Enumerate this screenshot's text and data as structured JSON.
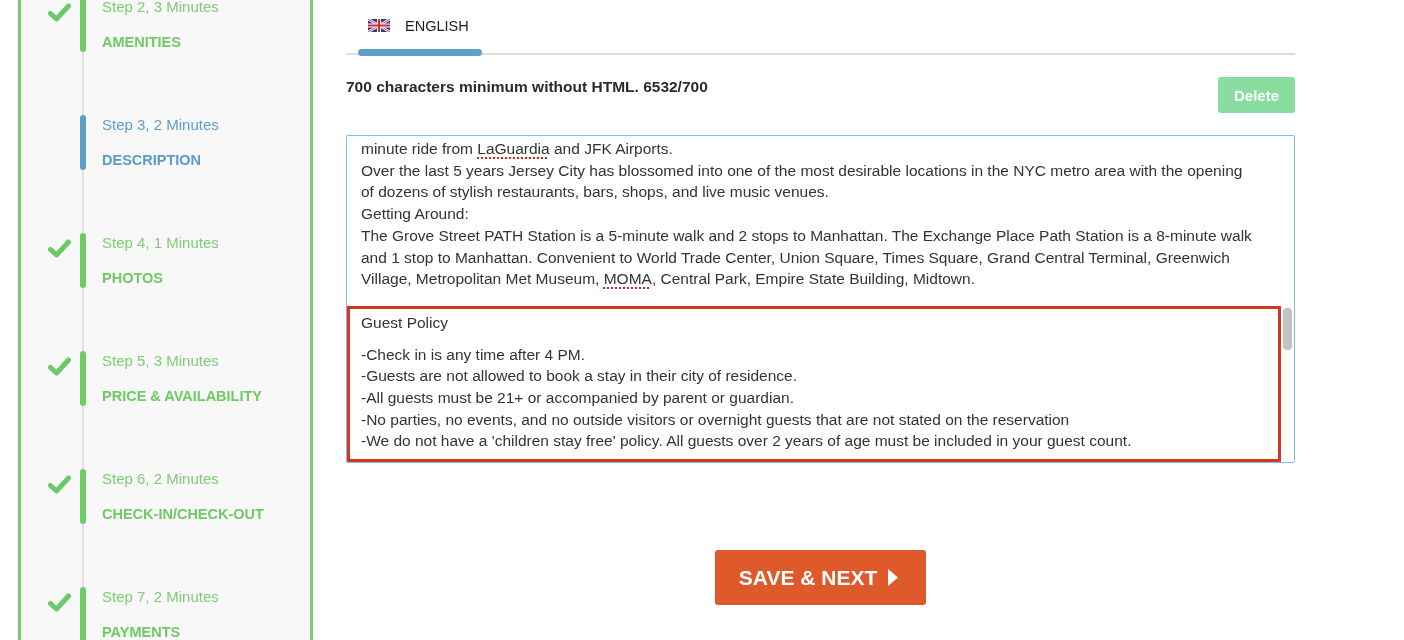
{
  "sidebar": {
    "steps": [
      {
        "label": "Step 2, 3 Minutes",
        "title": "AMENITIES",
        "completed": true,
        "selected": false
      },
      {
        "label": "Step 3, 2 Minutes",
        "title": "DESCRIPTION",
        "completed": false,
        "selected": true
      },
      {
        "label": "Step 4, 1 Minutes",
        "title": "PHOTOS",
        "completed": true,
        "selected": false
      },
      {
        "label": "Step 5, 3 Minutes",
        "title": "PRICE & AVAILABILITY",
        "completed": true,
        "selected": false
      },
      {
        "label": "Step 6, 2 Minutes",
        "title": "CHECK-IN/CHECK-OUT",
        "completed": true,
        "selected": false
      },
      {
        "label": "Step 7, 2 Minutes",
        "title": "PAYMENTS",
        "completed": true,
        "selected": false
      }
    ]
  },
  "tabs": [
    {
      "label": "ENGLISH",
      "selected": true
    }
  ],
  "editor": {
    "requirement_text": "700 characters minimum without HTML. 6532/700",
    "delete_button": {
      "label": "Delete",
      "disabled": true
    },
    "description_field": {
      "lines": [
        {
          "segments": [
            {
              "text": "minute ride from ",
              "misspelled": false
            },
            {
              "text": "LaGuardia",
              "misspelled": true
            },
            {
              "text": " and JFK Airports.",
              "misspelled": false
            }
          ]
        },
        {
          "segments": [
            {
              "text": "Over the last 5 years Jersey City has blossomed into one of the most desirable locations in the NYC metro area with the opening",
              "misspelled": false
            }
          ]
        },
        {
          "segments": [
            {
              "text": "of dozens of stylish restaurants, bars, shops, and live music venues.",
              "misspelled": false
            }
          ]
        },
        {
          "segments": [
            {
              "text": "Getting Around:",
              "misspelled": false
            }
          ]
        },
        {
          "segments": [
            {
              "text": "The Grove Street PATH Station is a 5-minute walk and 2 stops to Manhattan. The Exchange Place Path Station is a 8-minute walk",
              "misspelled": false
            }
          ]
        },
        {
          "segments": [
            {
              "text": "and 1 stop to Manhattan. Convenient to World Trade Center, Union Square, Times Square, Grand Central Terminal, Greenwich",
              "misspelled": false
            }
          ]
        },
        {
          "segments": [
            {
              "text": "Village, Metropolitan Met Museum, ",
              "misspelled": false
            },
            {
              "text": "MOMA",
              "misspelled": true
            },
            {
              "text": ", Central Park, Empire State Building, Midtown.",
              "misspelled": false
            }
          ]
        }
      ],
      "highlighted_section": {
        "title": "Guest Policy",
        "lines": [
          "-Check in is any time after 4 PM.",
          "-Guests are not allowed to book a stay in their city of residence.",
          "-All guests must be 21+ or accompanied by parent or guardian.",
          "-No parties, no events, and no outside visitors or overnight guests that are not stated on the reservation",
          "-We do not have a 'children stay free' policy. All guests over 2 years of age must be included in your guest count."
        ]
      }
    }
  },
  "save_button": {
    "label": "SAVE & NEXT"
  }
}
